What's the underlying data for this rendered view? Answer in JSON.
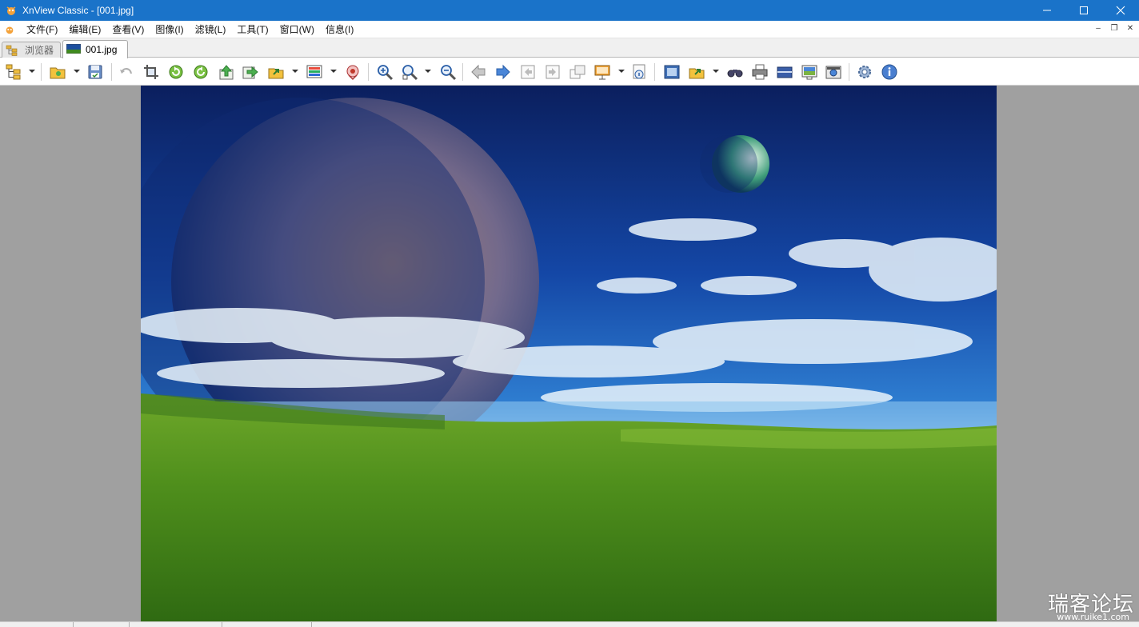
{
  "window": {
    "title": "XnView Classic - [001.jpg]",
    "minimize": "—",
    "maximize": "☐",
    "close": "✕"
  },
  "menubar": {
    "items": [
      "文件(F)",
      "编辑(E)",
      "查看(V)",
      "图像(I)",
      "滤镜(L)",
      "工具(T)",
      "窗口(W)",
      "信息(I)"
    ],
    "mdi_minimize": "–",
    "mdi_restore": "❐",
    "mdi_close": "✕"
  },
  "tabs": [
    {
      "label": "浏览器",
      "active": false
    },
    {
      "label": "001.jpg",
      "active": true
    }
  ],
  "toolbar": {
    "icons": [
      "browser-tree-icon",
      "open-folder-icon",
      "save-icon",
      "undo-icon",
      "crop-icon",
      "rotate-left-icon",
      "rotate-right-icon",
      "flip-up-icon",
      "flip-right-icon",
      "send-to-icon",
      "adjust-colors-icon",
      "red-eye-icon",
      "zoom-in-icon",
      "zoom-fit-icon",
      "zoom-out-icon",
      "previous-icon",
      "next-icon",
      "first-image-icon",
      "last-image-icon",
      "copy-window-icon",
      "slideshow-icon",
      "properties-icon",
      "fullscreen-icon",
      "export-icon",
      "find-icon",
      "print-icon",
      "scan-icon",
      "wallpaper-icon",
      "capture-icon",
      "settings-icon",
      "info-icon"
    ]
  },
  "colors": {
    "titlebar": "#1a73c9",
    "viewer_background": "#a0a0a0"
  },
  "image": {
    "filename": "001.jpg",
    "description_icon": "landscape-image"
  },
  "watermark": {
    "main": "瑞客论坛",
    "sub": "www.ruike1.com"
  }
}
